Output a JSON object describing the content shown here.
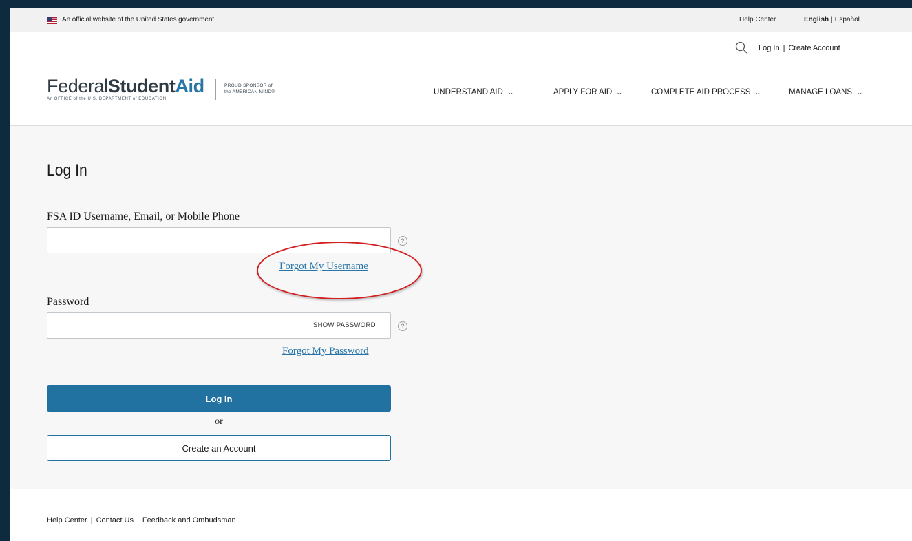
{
  "gov_banner": {
    "official_text": "An official website of the United States government.",
    "help_center": "Help Center",
    "lang_english": "English",
    "lang_divider": "|",
    "lang_spanish": "Español"
  },
  "utility": {
    "login": "Log In",
    "divider": "|",
    "create_account": "Create Account"
  },
  "logo": {
    "federal": "Federal",
    "student": "Student",
    "aid": "Aid",
    "office": "An OFFICE of the U.S. DEPARTMENT of EDUCATION",
    "sponsor_line1": "PROUD SPONSOR of",
    "sponsor_line2": "the AMERICAN MIND®"
  },
  "nav": [
    {
      "label": "UNDERSTAND AID"
    },
    {
      "label": "APPLY FOR AID"
    },
    {
      "label": "COMPLETE AID PROCESS"
    },
    {
      "label": "MANAGE LOANS"
    }
  ],
  "login_form": {
    "title": "Log In",
    "username_label": "FSA ID Username, Email, or Mobile Phone",
    "username_value": "",
    "forgot_username": "Forgot My Username",
    "password_label": "Password",
    "password_value": "",
    "show_password": "SHOW PASSWORD",
    "forgot_password": "Forgot My Password",
    "login_button": "Log In",
    "or_text": "or",
    "create_button": "Create an Account",
    "help_glyph": "?"
  },
  "footer": {
    "help_center": "Help Center",
    "contact": "Contact Us",
    "feedback": "Feedback and Ombudsman",
    "divider": "|"
  },
  "colors": {
    "brand_blue": "#2172a1",
    "annotation_red": "#d22020",
    "outer_background": "#0e2a3f"
  }
}
